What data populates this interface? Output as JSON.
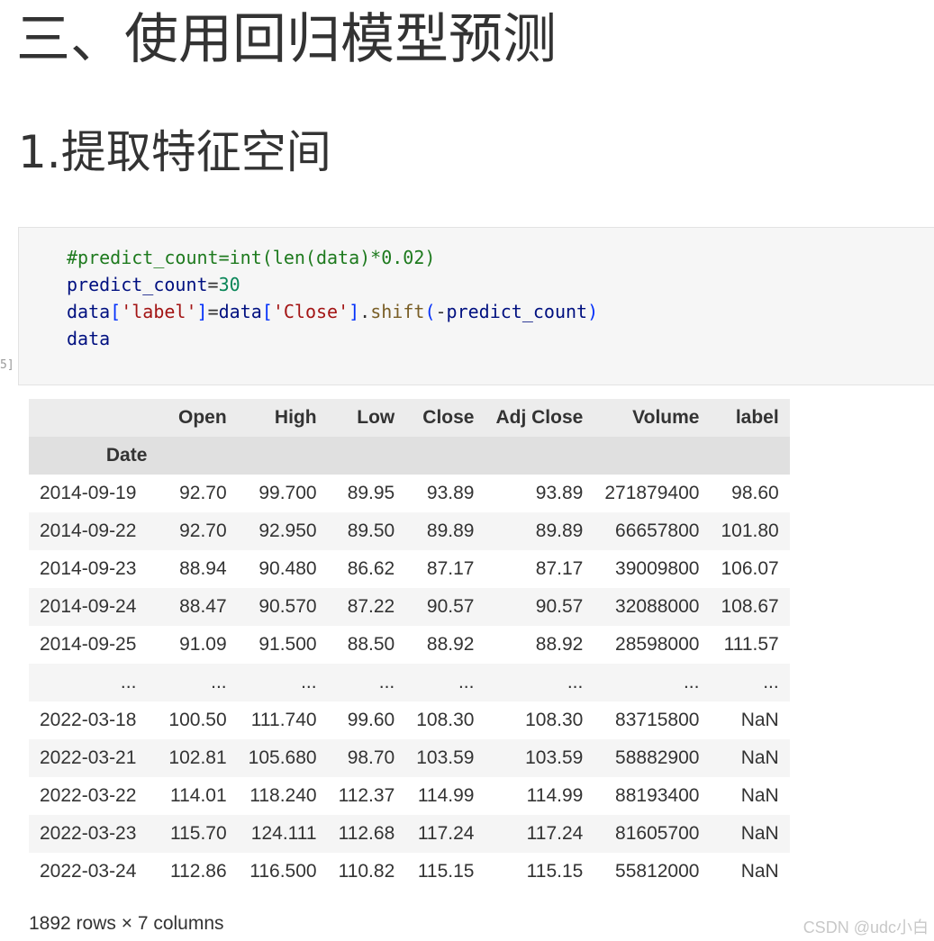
{
  "headings": {
    "section": "三、使用回归模型预测",
    "subsection": "1.提取特征空间"
  },
  "cell": {
    "prompt": "5]",
    "code_lines": [
      [
        {
          "t": "#predict_count=int(len(data)*0.02)",
          "c": "c-comment"
        }
      ],
      [
        {
          "t": "predict_count",
          "c": "c-name"
        },
        {
          "t": "=",
          "c": "c-op"
        },
        {
          "t": "30",
          "c": "c-num"
        }
      ],
      [
        {
          "t": "data",
          "c": "c-name"
        },
        {
          "t": "[",
          "c": "c-paren"
        },
        {
          "t": "'label'",
          "c": "c-str"
        },
        {
          "t": "]",
          "c": "c-paren"
        },
        {
          "t": "=",
          "c": "c-op"
        },
        {
          "t": "data",
          "c": "c-name"
        },
        {
          "t": "[",
          "c": "c-paren"
        },
        {
          "t": "'Close'",
          "c": "c-str"
        },
        {
          "t": "]",
          "c": "c-paren"
        },
        {
          "t": ".",
          "c": "c-op"
        },
        {
          "t": "shift",
          "c": "c-fn"
        },
        {
          "t": "(",
          "c": "c-paren"
        },
        {
          "t": "-",
          "c": "c-op"
        },
        {
          "t": "predict_count",
          "c": "c-name"
        },
        {
          "t": ")",
          "c": "c-paren"
        }
      ],
      [
        {
          "t": "data",
          "c": "c-name"
        }
      ]
    ]
  },
  "dataframe": {
    "columns": [
      "Open",
      "High",
      "Low",
      "Close",
      "Adj Close",
      "Volume",
      "label"
    ],
    "index_name": "Date",
    "rows": [
      {
        "index": "2014-09-19",
        "values": [
          "92.70",
          "99.700",
          "89.95",
          "93.89",
          "93.89",
          "271879400",
          "98.60"
        ]
      },
      {
        "index": "2014-09-22",
        "values": [
          "92.70",
          "92.950",
          "89.50",
          "89.89",
          "89.89",
          "66657800",
          "101.80"
        ]
      },
      {
        "index": "2014-09-23",
        "values": [
          "88.94",
          "90.480",
          "86.62",
          "87.17",
          "87.17",
          "39009800",
          "106.07"
        ]
      },
      {
        "index": "2014-09-24",
        "values": [
          "88.47",
          "90.570",
          "87.22",
          "90.57",
          "90.57",
          "32088000",
          "108.67"
        ]
      },
      {
        "index": "2014-09-25",
        "values": [
          "91.09",
          "91.500",
          "88.50",
          "88.92",
          "88.92",
          "28598000",
          "111.57"
        ]
      },
      {
        "index": "...",
        "values": [
          "...",
          "...",
          "...",
          "...",
          "...",
          "...",
          "..."
        ]
      },
      {
        "index": "2022-03-18",
        "values": [
          "100.50",
          "111.740",
          "99.60",
          "108.30",
          "108.30",
          "83715800",
          "NaN"
        ]
      },
      {
        "index": "2022-03-21",
        "values": [
          "102.81",
          "105.680",
          "98.70",
          "103.59",
          "103.59",
          "58882900",
          "NaN"
        ]
      },
      {
        "index": "2022-03-22",
        "values": [
          "114.01",
          "118.240",
          "112.37",
          "114.99",
          "114.99",
          "88193400",
          "NaN"
        ]
      },
      {
        "index": "2022-03-23",
        "values": [
          "115.70",
          "124.111",
          "112.68",
          "117.24",
          "117.24",
          "81605700",
          "NaN"
        ]
      },
      {
        "index": "2022-03-24",
        "values": [
          "112.86",
          "116.500",
          "110.82",
          "115.15",
          "115.15",
          "55812000",
          "NaN"
        ]
      }
    ],
    "shape_note": "1892 rows × 7 columns"
  },
  "watermark": "CSDN @udc小白"
}
